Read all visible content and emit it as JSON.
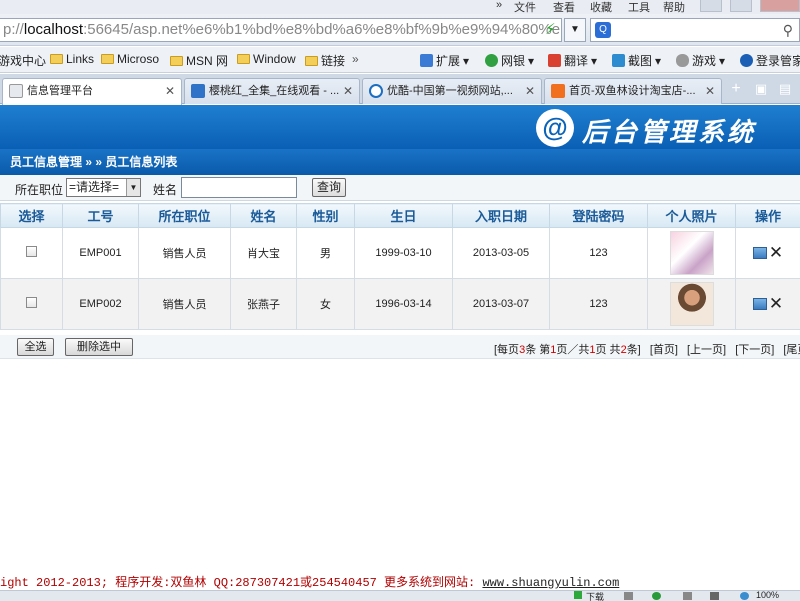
{
  "browser": {
    "menu": [
      "文件",
      "查看",
      "收藏",
      "工具",
      "帮助"
    ],
    "address_url_prefix": "p://",
    "address_host": "localhost",
    "address_rest": ":56645/asp.net%e6%b1%bd%e8%bd%a6%e8%bf%9b%e9%94%80%e",
    "favorites": [
      "游戏中心",
      "Links",
      "Microso",
      "MSN 网",
      "Window",
      "链接"
    ],
    "tools": [
      "扩展",
      "网银",
      "翻译",
      "截图",
      "游戏",
      "登录管家"
    ],
    "tabs": [
      {
        "title": "信息管理平台",
        "active": true
      },
      {
        "title": "樱桃红_全集_在线观看 - ...",
        "active": false
      },
      {
        "title": "优酷-中国第一视频网站,...",
        "active": false
      },
      {
        "title": "首页-双鱼林设计淘宝店-...",
        "active": false
      }
    ]
  },
  "header": {
    "logo_glyph": "@",
    "title": "后台管理系统",
    "breadcrumb": "员工信息管理 » » 员工信息列表"
  },
  "filter": {
    "position_label": "所在职位",
    "position_value": "=请选择=",
    "name_label": "姓名",
    "name_value": "",
    "query_button": "查询"
  },
  "table": {
    "headers": [
      "选择",
      "工号",
      "所在职位",
      "姓名",
      "性别",
      "生日",
      "入职日期",
      "登陆密码",
      "个人照片",
      "操作"
    ],
    "rows": [
      {
        "id": "EMP001",
        "position": "销售人员",
        "name": "肖大宝",
        "gender": "男",
        "birthday": "1999-03-10",
        "hire_date": "2013-03-05",
        "password": "123",
        "photo": "pink-magazine-photo"
      },
      {
        "id": "EMP002",
        "position": "销售人员",
        "name": "张燕子",
        "gender": "女",
        "birthday": "1996-03-14",
        "hire_date": "2013-03-07",
        "password": "123",
        "photo": "girl-portrait-photo"
      }
    ]
  },
  "actions": {
    "select_all": "全选",
    "delete_selected": "删除选中"
  },
  "pager": {
    "prefix": "[每页",
    "per_page": "3",
    "mid1": "条 第",
    "page": "1",
    "mid2": "页／共",
    "total_pages": "1",
    "mid3": "页 共",
    "total_records": "2",
    "suffix": "条]",
    "first": "[首页]",
    "prev": "[上一页]",
    "next": "[下一页]",
    "last": "[尾页"
  },
  "footer": {
    "copyright": "ight 2012-2013; 程序开发:双鱼林  QQ:287307421或254540457  更多系统到网站: ",
    "site": "www.shuangyulin.com"
  },
  "status": {
    "download": "下载",
    "zoom": "100%"
  },
  "colors": {
    "banner": "#0a5fb5",
    "header_text": "#1a5a98",
    "copyright": "#b10000",
    "pager_number": "#d00000"
  }
}
